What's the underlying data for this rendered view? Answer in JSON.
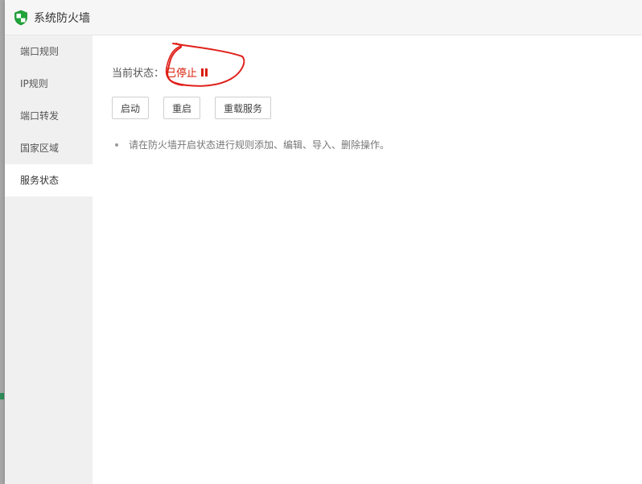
{
  "window": {
    "title": "系统防火墙"
  },
  "sidebar": {
    "items": [
      {
        "label": "端口规则",
        "active": false
      },
      {
        "label": "IP规则",
        "active": false
      },
      {
        "label": "端口转发",
        "active": false
      },
      {
        "label": "国家区域",
        "active": false
      },
      {
        "label": "服务状态",
        "active": true
      }
    ]
  },
  "main": {
    "status_label": "当前状态：",
    "status_value": "已停止",
    "status_icon": "pause-icon",
    "buttons": {
      "start": "启动",
      "restart": "重启",
      "reload": "重载服务"
    },
    "hint": "请在防火墙开启状态进行规则添加、编辑、导入、删除操作。"
  },
  "colors": {
    "status_stopped": "#d81e06",
    "shield_green": "#20a53a",
    "annotation_red": "#e0201a"
  }
}
